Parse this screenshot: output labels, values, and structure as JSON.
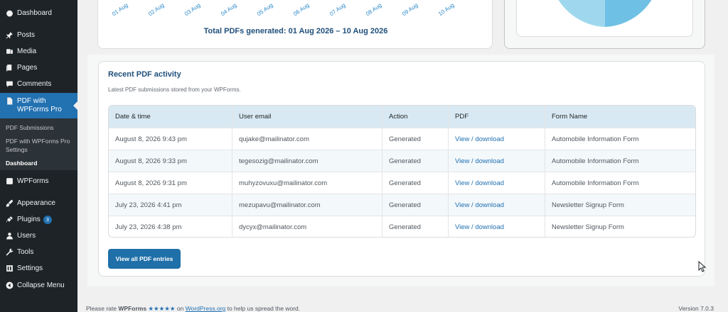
{
  "sidebar": {
    "items": [
      {
        "label": "Dashboard",
        "icon": "dashboard-icon"
      },
      {
        "label": "Posts",
        "icon": "pin-icon"
      },
      {
        "label": "Media",
        "icon": "media-icon"
      },
      {
        "label": "Pages",
        "icon": "pages-icon"
      },
      {
        "label": "Comments",
        "icon": "comment-icon"
      },
      {
        "label": "PDF with WPForms Pro",
        "icon": "document-icon"
      },
      {
        "label": "WPForms",
        "icon": "wpforms-icon"
      },
      {
        "label": "Appearance",
        "icon": "brush-icon"
      },
      {
        "label": "Plugins",
        "icon": "plugin-icon",
        "badge": "3"
      },
      {
        "label": "Users",
        "icon": "user-icon"
      },
      {
        "label": "Tools",
        "icon": "wrench-icon"
      },
      {
        "label": "Settings",
        "icon": "settings-icon"
      },
      {
        "label": "Collapse Menu",
        "icon": "collapse-icon"
      }
    ],
    "submenu": [
      {
        "label": "PDF Submissions"
      },
      {
        "label": "PDF with WPForms Pro Settings"
      },
      {
        "label": "Dashboard"
      }
    ]
  },
  "chart_top": {
    "tick_labels": [
      "01 Aug",
      "02 Aug",
      "03 Aug",
      "04 Aug",
      "05 Aug",
      "06 Aug",
      "07 Aug",
      "08 Aug",
      "09 Aug",
      "10 Aug"
    ],
    "total_text": "Total PDFs generated: 01 Aug 2026 – 10 Aug 2026"
  },
  "activity": {
    "title": "Recent PDF activity",
    "description": "Latest PDF submissions stored from your WPForms.",
    "columns": [
      "Date & time",
      "User email",
      "Action",
      "PDF",
      "Form Name"
    ],
    "rows": [
      [
        "August 8, 2026 9:43 pm",
        "qujake@mailinator.com",
        "Generated",
        "View / download",
        "Automobile Information Form"
      ],
      [
        "August 8, 2026 9:33 pm",
        "tegesozig@mailinator.com",
        "Generated",
        "View / download",
        "Automobile Information Form"
      ],
      [
        "August 8, 2026 9:31 pm",
        "muhyzovuxu@mailinator.com",
        "Generated",
        "View / download",
        "Automobile Information Form"
      ],
      [
        "July 23, 2026 4:41 pm",
        "mezupavu@mailinator.com",
        "Generated",
        "View / download",
        "Newsletter Signup Form"
      ],
      [
        "July 23, 2026 4:38 pm",
        "dycyx@mailinator.com",
        "Generated",
        "View / download",
        "Newsletter Signup Form"
      ]
    ],
    "button_label": "View all PDF entries"
  },
  "footer": {
    "prefix": "Please rate ",
    "brand": "WPForms",
    "stars": "★★★★★",
    "on": " on ",
    "link": "WordPress.org",
    "suffix": " to help us spread the word.",
    "version": "Version 7.0.3"
  },
  "colors": {
    "sidebar_bg": "#1d2327",
    "accent": "#2271b1",
    "pie_light": "#9fd8ee",
    "pie_dark": "#6ec1e4"
  }
}
